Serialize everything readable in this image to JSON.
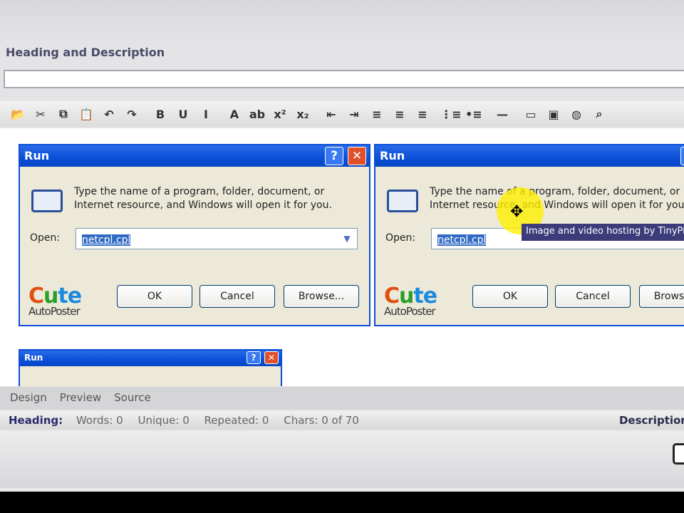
{
  "section_title": "Heading and Description",
  "toolbar": {
    "icons": [
      "open-folder-icon",
      "cut-icon",
      "copy-icon",
      "paste-icon",
      "undo-icon",
      "redo-icon",
      "bold-icon",
      "underline-icon",
      "italic-icon",
      "font-color-icon",
      "strikethrough-icon",
      "superscript-icon",
      "subscript-icon",
      "outdent-icon",
      "indent-icon",
      "align-left-icon",
      "align-center-icon",
      "align-right-icon",
      "ordered-list-icon",
      "unordered-list-icon",
      "horizontal-rule-icon",
      "table-icon",
      "image-icon",
      "link-icon",
      "find-icon"
    ],
    "glyphs": [
      "📂",
      "✂",
      "⧉",
      "📋",
      "↶",
      "↷",
      "B",
      "U",
      "I",
      "A",
      "ab",
      "x²",
      "x₂",
      "⇤",
      "⇥",
      "≡",
      "≡",
      "≡",
      "⋮≡",
      "•≡",
      "—",
      "▭",
      "▣",
      "◍",
      "⌕"
    ]
  },
  "dialogs": [
    {
      "title": "Run",
      "help": "?",
      "close": "✕",
      "message_line1": "Type the name of a program, folder, document, or",
      "message_line2": "Internet resource, and Windows will open it for you.",
      "open_label": "Open:",
      "open_value": "netcpl.cpl",
      "ok": "OK",
      "cancel": "Cancel",
      "browse": "Browse..."
    },
    {
      "title": "Run",
      "help": "?",
      "close": "✕",
      "message_line1": "Type the name of a program, folder, document, or",
      "message_line2": "Internet resource, and Windows will open it for you.",
      "open_label": "Open:",
      "open_value": "netcpl.cpl",
      "ok": "OK",
      "cancel": "Cancel",
      "browse": "Browse..."
    },
    {
      "title": "Run",
      "help": "?",
      "close": "✕"
    }
  ],
  "watermark": {
    "text1": "Cute",
    "text2": "AutoPoster"
  },
  "tooltip": "Image and video hosting by TinyPic",
  "tabs": [
    "Design",
    "Preview",
    "Source"
  ],
  "status": {
    "heading_label": "Heading:",
    "words": "Words: 0",
    "unique": "Unique: 0",
    "repeated": "Repeated: 0",
    "chars": "Chars: 0 of 70",
    "description_label": "Description"
  }
}
